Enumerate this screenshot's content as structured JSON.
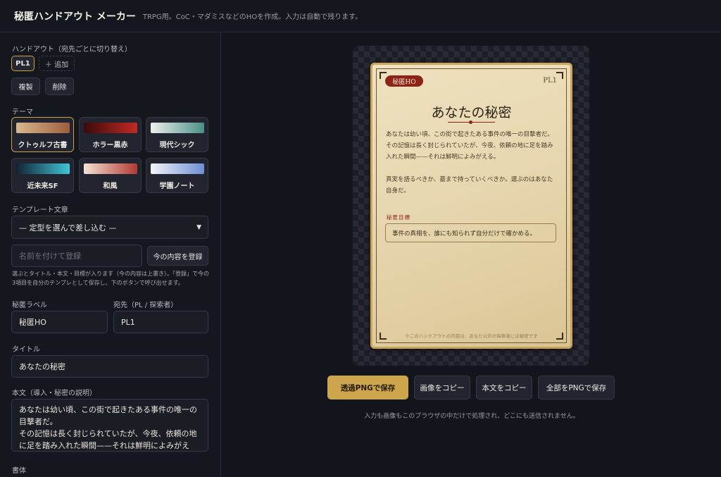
{
  "header": {
    "title": "秘匿ハンドアウト メーカー",
    "subtitle": "TRPG用。CoC・マダミスなどのHOを作成。入力は自動で残ります。"
  },
  "sidebar": {
    "handout_label": "ハンドアウト（宛先ごとに切り替え）",
    "handouts": [
      "PL1"
    ],
    "add_label": "＋ 追加",
    "duplicate_label": "複製",
    "delete_label": "削除",
    "theme_label": "テーマ",
    "themes": [
      {
        "name": "クトゥルフ古書",
        "grad_from": "#d9b98c",
        "grad_to": "#9c5e3a"
      },
      {
        "name": "ホラー黒赤",
        "grad_from": "#3a0b0b",
        "grad_to": "#c22a22"
      },
      {
        "name": "現代シック",
        "grad_from": "#eef0ec",
        "grad_to": "#4a8f86"
      },
      {
        "name": "近未来SF",
        "grad_from": "#132235",
        "grad_to": "#3fc6d8"
      },
      {
        "name": "和風",
        "grad_from": "#f3e2d4",
        "grad_to": "#b13a32"
      },
      {
        "name": "学園ノート",
        "grad_from": "#f2f4f7",
        "grad_to": "#6f8fd4"
      }
    ],
    "active_theme": "クトゥルフ古書",
    "template_label": "テンプレート文章",
    "template_select": "— 定型を選んで差し込む —",
    "template_name_placeholder": "名前を付けて登録",
    "register_button": "今の内容を登録",
    "template_help": "選ぶとタイトル・本文・目標が入ります（今の内容は上書き）。「登録」で今の3項目を自分のテンプレとして保存し、下のボタンで呼び出せます。",
    "secret_label_label": "秘匿ラベル",
    "secret_label_value": "秘匿HO",
    "recipient_label": "宛先（PL / 探索者）",
    "recipient_value": "PL1",
    "title_label": "タイトル",
    "title_value": "あなたの秘密",
    "body_label": "本文（導入・秘密の説明）",
    "body_lines": [
      "あなたは幼い頃、この街で起きたある事件の唯一の目撃者だ。",
      "その記憶は長く封じられていたが、今夜、依頼の地に足を踏み入れた瞬間——それは鮮明によみがえる。"
    ],
    "font_label": "書体"
  },
  "card": {
    "badge": "秘匿HO",
    "recipient": "PL1",
    "title": "あなたの秘密",
    "body": [
      "あなたは幼い頃、この街で起きたある事件の唯一の目撃者だ。",
      "その記憶は長く封じられていたが、今夜、依頼の地に足を踏み入れた瞬間——それは鮮明によみがえる。",
      "",
      "真実を語るべきか、墓まで持っていくべきか。選ぶのはあなた自身だ。"
    ],
    "goal_label": "秘匿目標",
    "goal": "事件の真相を、誰にも知られず自分だけで確かめる。",
    "footer": "※このハンドアウトの内容は、あなた以外の探索者には秘密です"
  },
  "actions": {
    "save_png": "透過PNGで保存",
    "copy_image": "画像をコピー",
    "copy_text": "本文をコピー",
    "save_all": "全部をPNGで保存"
  },
  "note": "入力も画像もこのブラウザの中だけで処理され、どこにも送信されません。"
}
